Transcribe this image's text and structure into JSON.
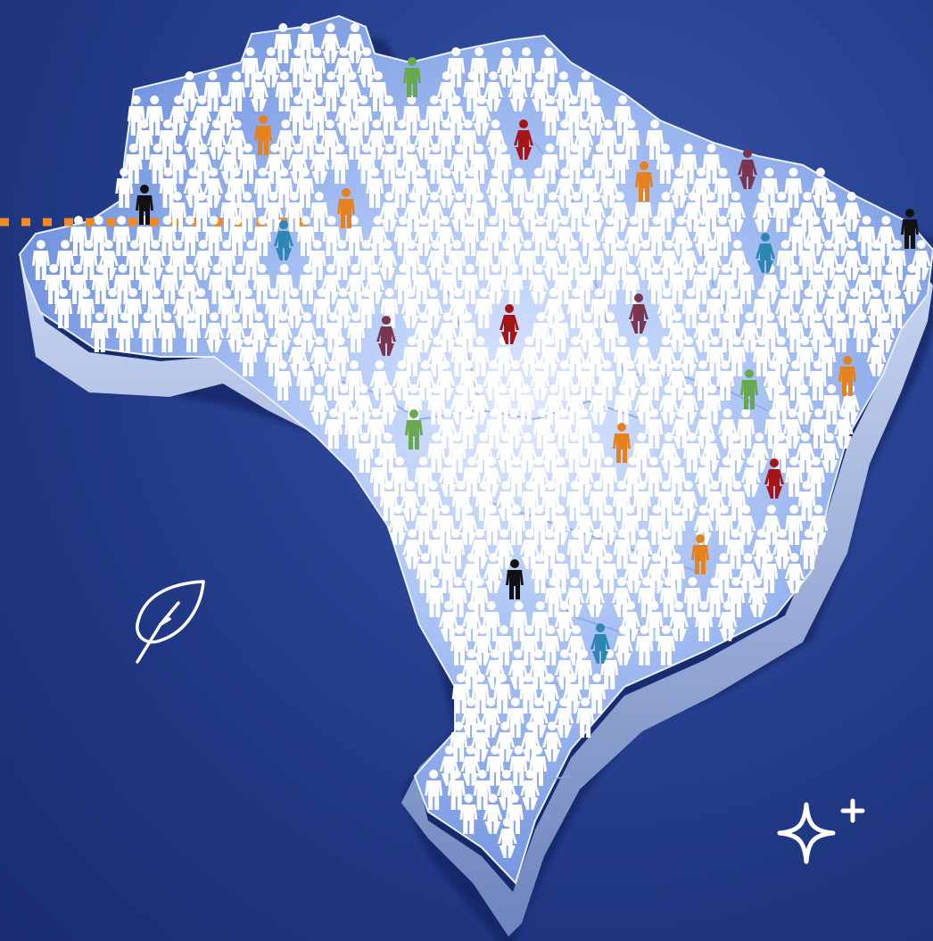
{
  "scene": {
    "subject": "map-of-brazil-with-crowd-of-people-icons",
    "background_color": "#23398a",
    "map_fill_light": "#cfe0ff",
    "map_fill_mid": "#6f93de",
    "map_edge_color": "#9fb3dc"
  },
  "people": {
    "default_color": "#ffffff",
    "highlight_colors": {
      "green": "#6aa84f",
      "orange": "#e6821e",
      "red": "#a51515",
      "maroon": "#7a3550",
      "teal": "#2e86b3",
      "black": "#111111"
    }
  },
  "decorations": {
    "dotted_line_color": "#f08a24",
    "leaf_icon": "leaf-icon",
    "sparkle_icon": "sparkle-icon",
    "icon_color": "#ffffff"
  }
}
